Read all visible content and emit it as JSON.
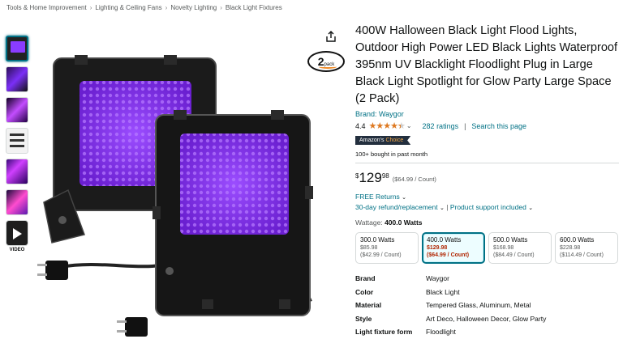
{
  "breadcrumb": [
    "Tools & Home Improvement",
    "Lighting & Ceiling Fans",
    "Novelty Lighting",
    "Black Light Fixtures"
  ],
  "thumbnails": {
    "video_label": "VIDEO"
  },
  "badge": {
    "count": "2",
    "unit": "pack"
  },
  "product": {
    "title": "400W Halloween Black Light Flood Lights, Outdoor High Power LED Black Lights Waterproof 395nm UV Blacklight Floodlight Plug in Large Black Light Spotlight for Glow Party Large Space (2 Pack)",
    "brand": "Brand: Waygor",
    "rating": "4.4",
    "rating_stars": 4.4,
    "ratings_count": "282 ratings",
    "search_page": "Search this page",
    "choice_prefix": "Amazon's",
    "choice_word": "Choice",
    "bought": "100+ bought in past month",
    "price_symbol": "$",
    "price_whole": "129",
    "price_fraction": "98",
    "price_unit": "($64.99 / Count)",
    "free_returns": "FREE Returns",
    "refund": "30-day refund/replacement",
    "support": "Product support included",
    "wattage_label": "Wattage:",
    "wattage_value": "400.0 Watts"
  },
  "options": [
    {
      "watts": "300.0 Watts",
      "price": "$85.98",
      "unit": "($42.99 / Count)",
      "selected": false
    },
    {
      "watts": "400.0 Watts",
      "price": "$129.98",
      "unit": "($64.99 / Count)",
      "selected": true
    },
    {
      "watts": "500.0 Watts",
      "price": "$168.98",
      "unit": "($84.49 / Count)",
      "selected": false
    },
    {
      "watts": "600.0 Watts",
      "price": "$228.98",
      "unit": "($114.49 / Count)",
      "selected": false
    }
  ],
  "specs": [
    {
      "key": "Brand",
      "value": "Waygor"
    },
    {
      "key": "Color",
      "value": "Black Light"
    },
    {
      "key": "Material",
      "value": "Tempered Glass, Aluminum, Metal"
    },
    {
      "key": "Style",
      "value": "Art Deco, Halloween Decor, Glow Party"
    },
    {
      "key": "Light fixture form",
      "value": "Floodlight"
    }
  ],
  "colors": {
    "link": "#007185",
    "star": "#de7921",
    "price_red": "#b12704",
    "uv_purple": "#8a3cff",
    "choice_bg": "#232f3e"
  }
}
